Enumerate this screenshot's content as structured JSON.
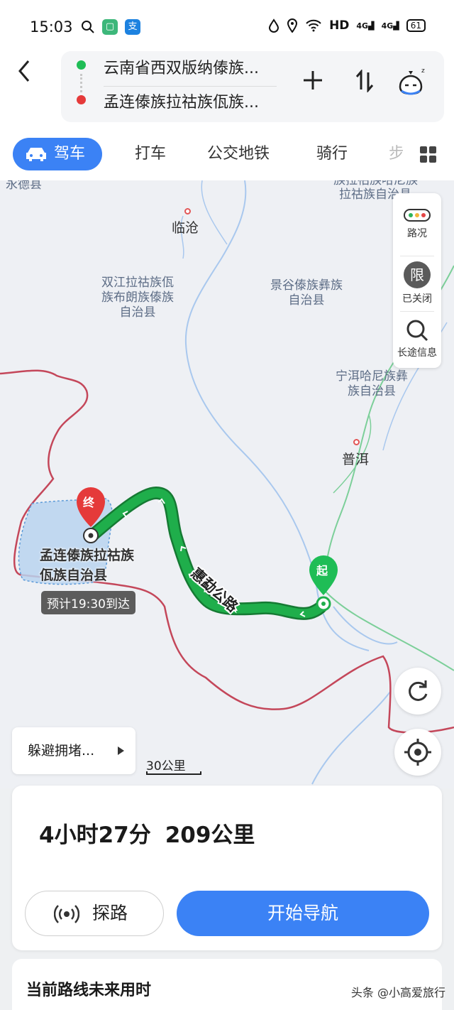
{
  "status_bar": {
    "time": "15:03",
    "network": "HD",
    "signal1": "4G",
    "signal2": "4G",
    "battery": "61"
  },
  "header": {
    "origin": "云南省西双版纳傣族...",
    "destination": "孟连傣族拉祜族佤族...",
    "add_icon": "plus-icon",
    "swap_icon": "swap-icon"
  },
  "tabs": [
    {
      "label": "驾车",
      "active": true
    },
    {
      "label": "打车"
    },
    {
      "label": "公交地铁"
    },
    {
      "label": "骑行"
    },
    {
      "label": "步"
    }
  ],
  "map": {
    "labels": {
      "yongde": "永德县",
      "lancang": "族拉祜族哈尼族",
      "lancang2": "拉祜族自治县",
      "lincang": "临沧",
      "shuangjiang": "双江拉祜族佤族布朗族傣族自治县",
      "jinggu": "景谷傣族彝族自治县",
      "ninger": "宁洱哈尼族彝族自治县",
      "puer": "普洱",
      "road": "惠勐公路",
      "start_marker": "起",
      "end_marker": "终",
      "destination": "孟连傣族拉祜族佤族自治县",
      "eta": "预计19:30到达"
    },
    "side_panel": {
      "traffic": "路况",
      "limit_icon": "限",
      "limit": "已关闭",
      "long_trip": "长途信息"
    },
    "avoid": "躲避拥堵...",
    "scale": "30公里"
  },
  "route_summary": {
    "duration": "4小时27分",
    "distance": "209公里"
  },
  "actions": {
    "explore": "探路",
    "navigate": "开始导航"
  },
  "future": {
    "title": "当前路线未来用时"
  },
  "watermark": "头条 @小高爱旅行",
  "colors": {
    "accent": "#3b82f5",
    "route": "#1fae4b",
    "start": "#1fbd56",
    "end": "#e53a3a",
    "border": "#c4475a"
  }
}
